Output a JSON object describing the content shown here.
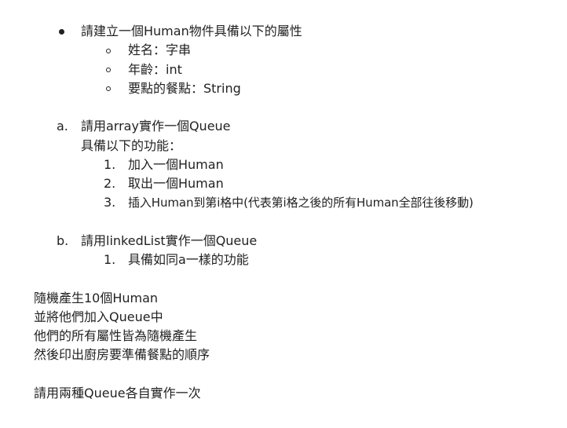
{
  "section_1": {
    "heading": "請建立一個Human物件具備以下的屬性",
    "properties": [
      "姓名：字串",
      "年齡：int",
      "要點的餐點：String"
    ]
  },
  "section_a": {
    "marker": "a.",
    "line1": "請用array實作一個Queue",
    "line2": "具備以下的功能：",
    "functions": [
      {
        "num": "1.",
        "text": "加入一個Human"
      },
      {
        "num": "2.",
        "text": "取出一個Human"
      },
      {
        "num": "3.",
        "text": "插入Human到第i格中(代表第i格之後的所有Human全部往後移動)"
      }
    ]
  },
  "section_b": {
    "marker": "b.",
    "line1": "請用linkedList實作一個Queue",
    "items": [
      {
        "num": "1.",
        "text": "具備如同a一樣的功能"
      }
    ]
  },
  "paragraph": [
    "隨機產生10個Human",
    "並將他們加入Queue中",
    "他們的所有屬性皆為隨機產生",
    "然後印出廚房要準備餐點的順序"
  ],
  "closing": "請用兩種Queue各自實作一次"
}
